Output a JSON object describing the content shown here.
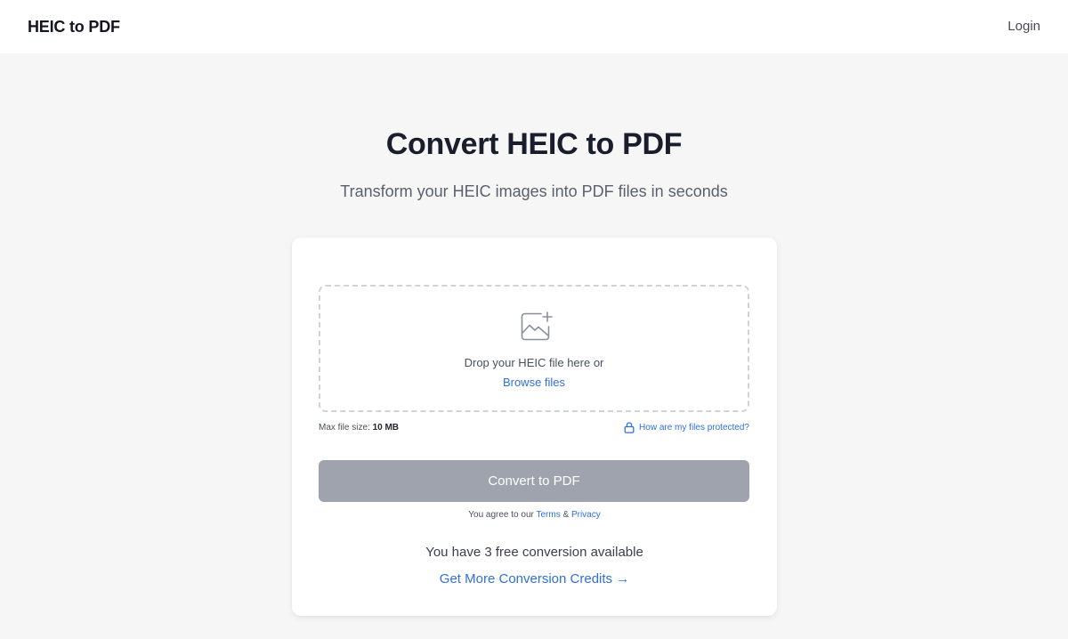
{
  "header": {
    "brand": "HEIC to PDF",
    "login_label": "Login"
  },
  "hero": {
    "title": "Convert HEIC to PDF",
    "subtitle": "Transform your HEIC images into PDF files in seconds"
  },
  "upload": {
    "icon": "image-add-icon",
    "drop_text": "Drop your HEIC file here or",
    "browse_label": "Browse files",
    "max_size_label": "Max file size:",
    "max_size_value": "10 MB",
    "protect_label": "How are my files protected?",
    "protect_icon": "lock-icon"
  },
  "actions": {
    "convert_label": "Convert to PDF",
    "agree_prefix": "You agree to our",
    "terms_label": "Terms",
    "and_sep": "&",
    "privacy_label": "Privacy"
  },
  "credits": {
    "free_text": "You have 3 free conversion available",
    "more_label": "Get More Conversion Credits →"
  },
  "colors": {
    "accent": "#2f6fe0",
    "button_disabled": "#9ea3ae",
    "page_bg": "#f6f6f7"
  }
}
